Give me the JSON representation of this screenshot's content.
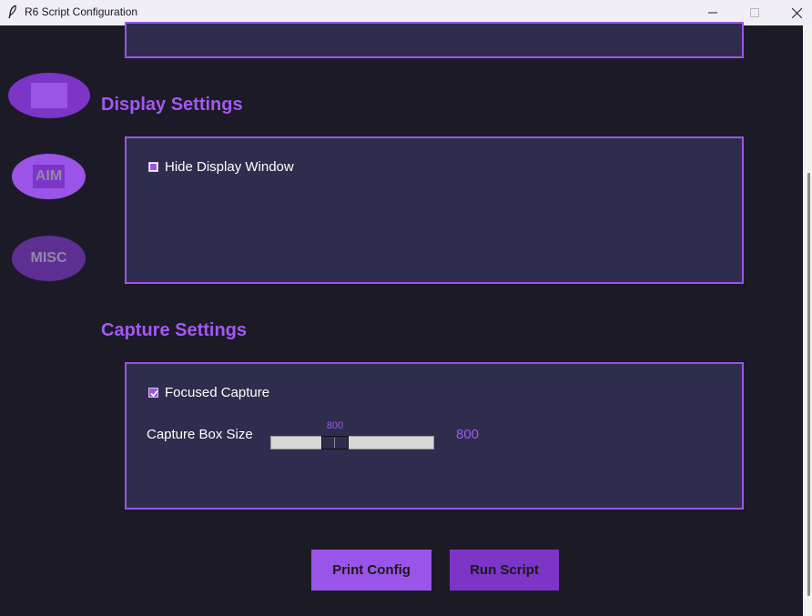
{
  "window": {
    "title": "R6 Script Configuration"
  },
  "nav": {
    "aim_label": "AIM",
    "misc_label": "MISC"
  },
  "display": {
    "title": "Display Settings",
    "hide_window": {
      "label": "Hide Display Window",
      "checked": false
    }
  },
  "capture": {
    "title": "Capture Settings",
    "focused": {
      "label": "Focused Capture",
      "checked": true
    },
    "box_size": {
      "label": "Capture Box Size",
      "value": "800",
      "slider_value_label": "800"
    }
  },
  "buttons": {
    "print": "Print Config",
    "run": "Run Script"
  },
  "colors": {
    "accent": "#9a55e8",
    "accent_dark": "#7c35c7",
    "panel": "#2e2d4d",
    "background": "#1c1a27"
  }
}
